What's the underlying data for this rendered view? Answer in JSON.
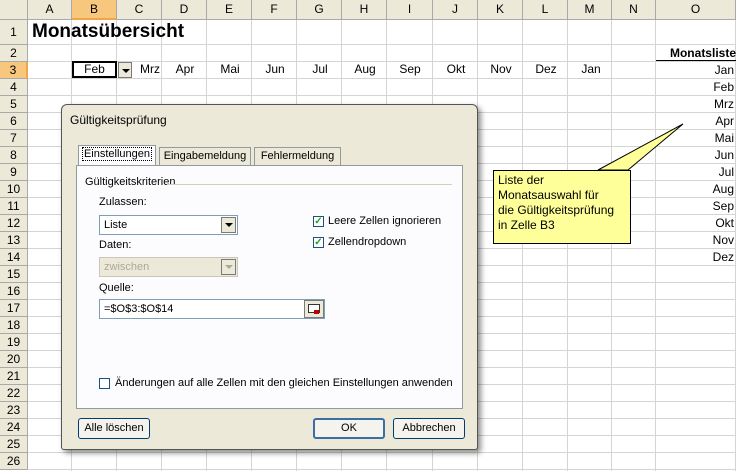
{
  "sheet": {
    "columns": [
      "A",
      "B",
      "C",
      "D",
      "E",
      "F",
      "G",
      "H",
      "I",
      "J",
      "K",
      "L",
      "M",
      "N",
      "O"
    ],
    "rows": [
      "1",
      "2",
      "3",
      "4",
      "5",
      "6",
      "7",
      "8",
      "9",
      "10",
      "11",
      "12",
      "13",
      "14",
      "15",
      "16",
      "17",
      "18",
      "19",
      "20",
      "21",
      "22",
      "23",
      "24",
      "25",
      "26"
    ],
    "title": "Monatsübersicht",
    "active_cell_value": "Feb",
    "row3_months": [
      "Mrz",
      "Apr",
      "Mai",
      "Jun",
      "Jul",
      "Aug",
      "Sep",
      "Okt",
      "Nov",
      "Dez",
      "Jan"
    ],
    "list_header": "Monatsliste",
    "list_months": [
      "Jan",
      "Feb",
      "Mrz",
      "Apr",
      "Mai",
      "Jun",
      "Jul",
      "Aug",
      "Sep",
      "Okt",
      "Nov",
      "Dez"
    ],
    "selected_col_color": "#f7c77e"
  },
  "callout": {
    "lines": [
      "Liste der",
      "Monatsauswahl für",
      "die Gültigkeitsprüfung",
      "in Zelle B3"
    ],
    "bg_color": "#ffff99"
  },
  "dialog": {
    "title": "Gültigkeitsprüfung",
    "tabs": [
      "Einstellungen",
      "Eingabemeldung",
      "Fehlermeldung"
    ],
    "group_label": "Gültigkeitskriterien",
    "allow_label": "Zulassen:",
    "allow_value": "Liste",
    "data_label": "Daten:",
    "data_value": "zwischen",
    "source_label": "Quelle:",
    "source_value": "=$O$3:$O$14",
    "ignore_blank_label": "Leere Zellen ignorieren",
    "dropdown_label": "Zellendropdown",
    "apply_all_label": "Änderungen auf alle Zellen mit den gleichen Einstellungen anwenden",
    "clear_all_button": "Alle löschen",
    "ok_button": "OK",
    "cancel_button": "Abbrechen",
    "icon_names": [
      "dropdown-arrow-icon",
      "range-select-icon",
      "checkbox-checked-icon"
    ]
  }
}
